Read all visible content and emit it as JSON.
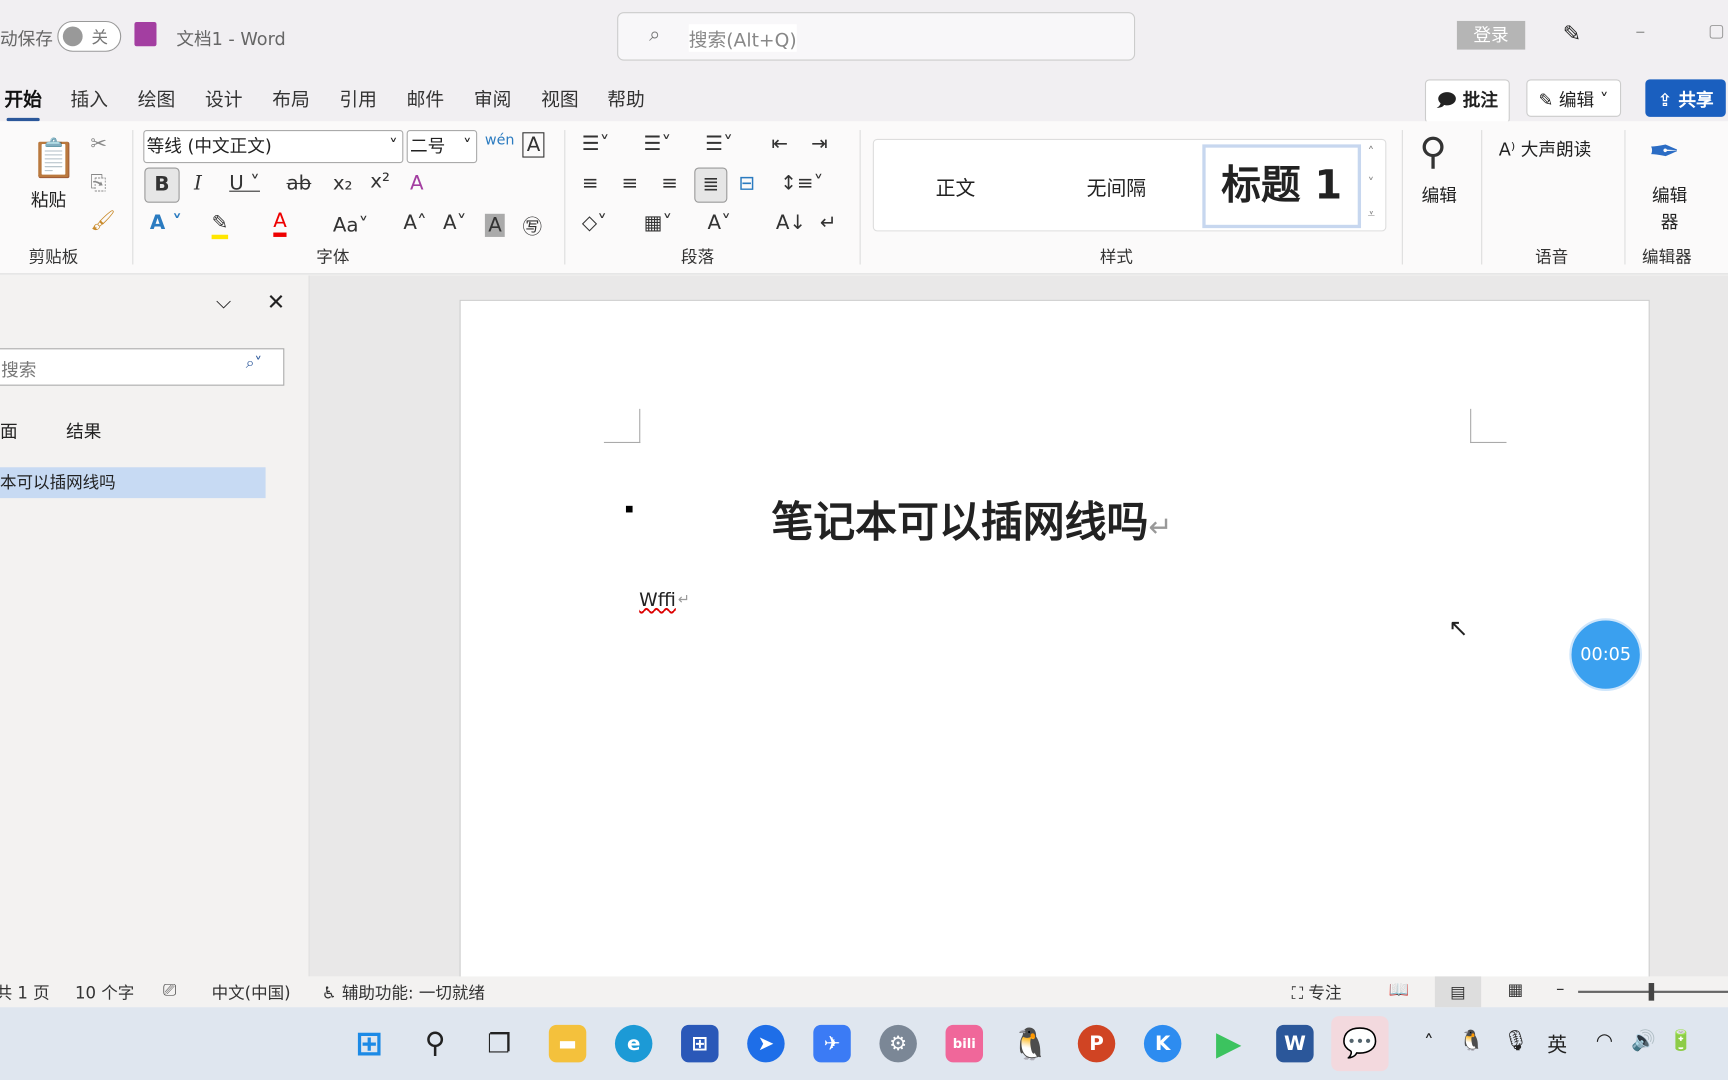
{
  "titlebar": {
    "autosave": "动保存",
    "toggle": "关",
    "doc_title": "文档1  -  Word",
    "search_placeholder": "搜索(Alt+Q)",
    "login": "登录"
  },
  "tabs": [
    "开始",
    "插入",
    "绘图",
    "设计",
    "布局",
    "引用",
    "邮件",
    "审阅",
    "视图",
    "帮助"
  ],
  "actions": {
    "comment": "批注",
    "edit": "编辑",
    "share": "共享"
  },
  "ribbon": {
    "paste": "粘贴",
    "font_name": "等线 (中文正文)",
    "font_size": "二号",
    "styles": [
      "正文",
      "无间隔",
      "标题 1"
    ],
    "find": "编辑",
    "read_aloud": "大声朗读",
    "editor": "编辑器",
    "groups": [
      "剪贴板",
      "字体",
      "段落",
      "样式",
      "语音",
      "编辑器"
    ]
  },
  "nav": {
    "search_placeholder": "搜索",
    "tabs": [
      "页面",
      "结果"
    ],
    "heading": "本可以插网线吗"
  },
  "document": {
    "heading": "笔记本可以插网线吗",
    "body": "Wffi"
  },
  "timer": "00:05",
  "status": {
    "page": "共 1 页",
    "words": "10 个字",
    "lang": "中文(中国)",
    "accessibility": "辅助功能: 一切就绪",
    "focus": "专注"
  },
  "tray": {
    "ime": "英"
  },
  "colors": {
    "accent": "#2b579a",
    "share": "#1a5fbf",
    "timer": "#3aa0ef"
  }
}
